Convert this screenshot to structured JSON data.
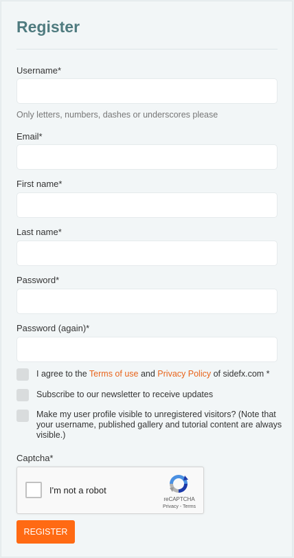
{
  "form": {
    "title": "Register",
    "username": {
      "label": "Username*",
      "value": "",
      "help": "Only letters, numbers, dashes or underscores please"
    },
    "email": {
      "label": "Email*",
      "value": ""
    },
    "first_name": {
      "label": "First name*",
      "value": ""
    },
    "last_name": {
      "label": "Last name*",
      "value": ""
    },
    "password": {
      "label": "Password*",
      "value": ""
    },
    "password_again": {
      "label": "Password (again)*",
      "value": ""
    },
    "terms": {
      "prefix": "I agree to the ",
      "terms_link": "Terms of use",
      "and": " and ",
      "privacy_link": "Privacy Policy",
      "suffix": " of sidefx.com *",
      "checked": false
    },
    "newsletter": {
      "label": "Subscribe to our newsletter to receive updates",
      "checked": false
    },
    "profile_visible": {
      "label": "Make my user profile visible to unregistered visitors? (Note that your username, published gallery and tutorial content are always visible.)",
      "checked": false
    },
    "captcha": {
      "label": "Captcha*",
      "checkbox_label": "I'm not a robot",
      "brand": "reCAPTCHA",
      "privacy": "Privacy",
      "separator": " - ",
      "terms": "Terms"
    },
    "submit_label": "REGISTER"
  },
  "colors": {
    "accent": "#ff6a13",
    "title": "#4f7b7f",
    "link": "#e8641b"
  }
}
